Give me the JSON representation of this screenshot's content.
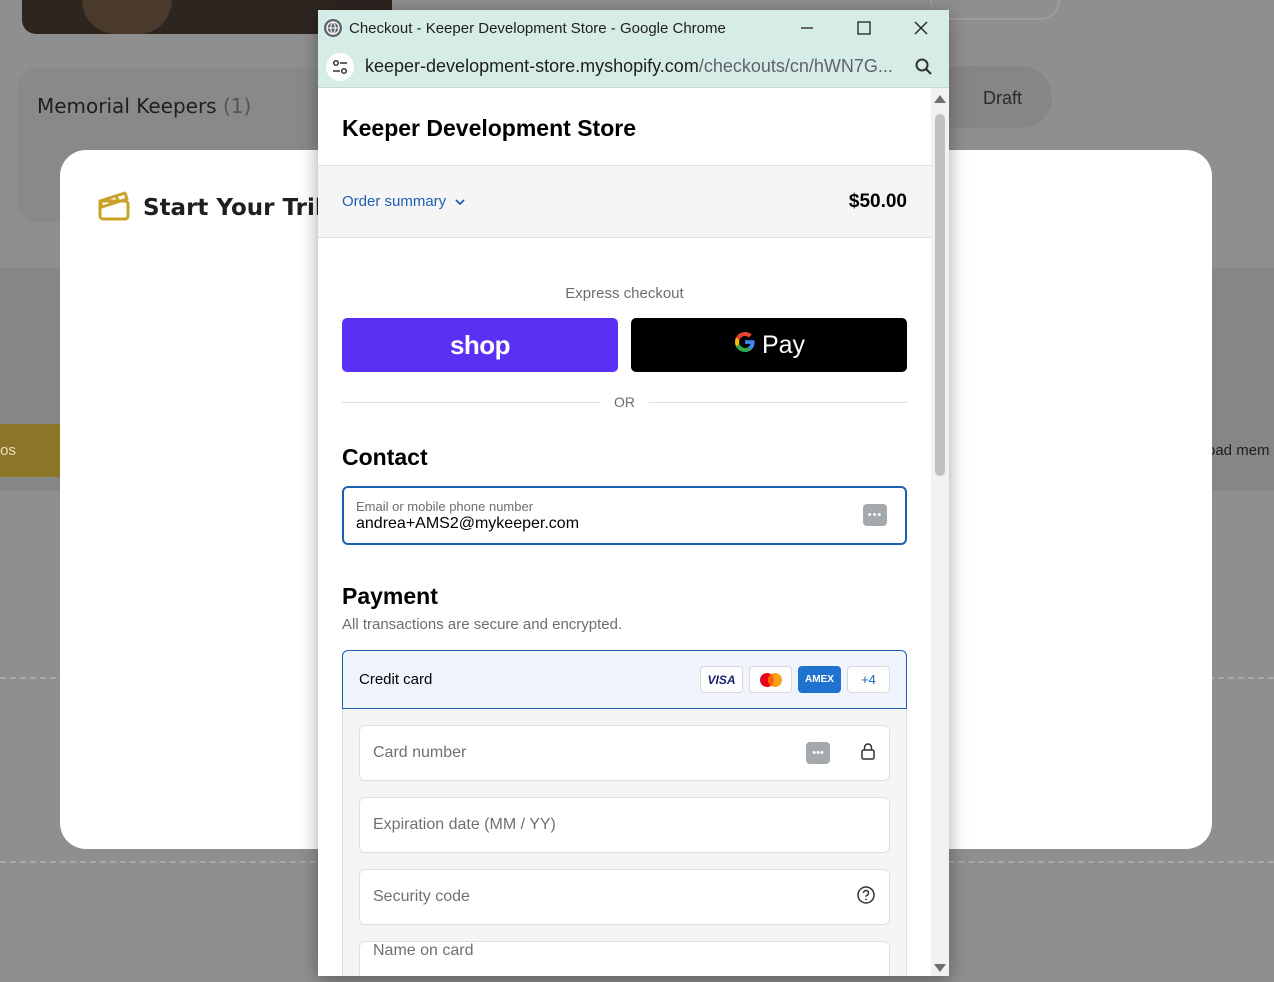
{
  "background": {
    "keepers_title": "Memorial Keepers",
    "keepers_count": "(1)",
    "draft_label": "Draft",
    "gold_tab_text": "tos",
    "upload_text": "oad mem"
  },
  "modal": {
    "title": "Start Your Tribut"
  },
  "window": {
    "title": "Checkout - Keeper Development Store - Google Chrome",
    "url_host": "keeper-development-store.myshopify.com",
    "url_path": "/checkouts/cn/hWN7G..."
  },
  "checkout": {
    "store_name": "Keeper Development Store",
    "order_summary_label": "Order summary",
    "order_total": "$50.00",
    "express_label": "Express checkout",
    "shop_pay_label": "shop",
    "gpay_label": "Pay",
    "or_label": "OR",
    "contact_title": "Contact",
    "email_label": "Email or mobile phone number",
    "email_value": "andrea+AMS2@mykeeper.com",
    "payment_title": "Payment",
    "secure_note": "All transactions are secure and encrypted.",
    "credit_card_label": "Credit card",
    "card_brands": [
      "VISA",
      "mastercard",
      "AMEX",
      "+4"
    ],
    "card_number_placeholder": "Card number",
    "expiration_placeholder": "Expiration date (MM / YY)",
    "security_code_placeholder": "Security code",
    "name_on_card_placeholder": "Name on card"
  },
  "colors": {
    "accent": "#1d5fb5",
    "shop_pay": "#5a31f4",
    "chrome_frame": "#d6ece7"
  }
}
